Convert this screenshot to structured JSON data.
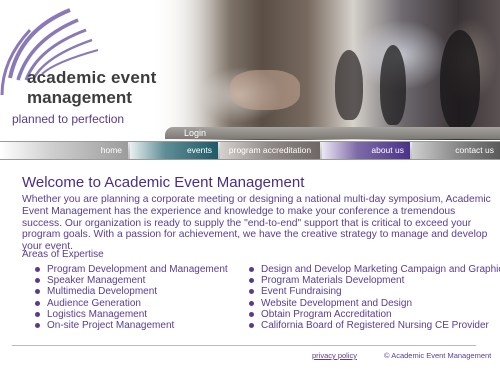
{
  "header": {
    "logo_line1": "academic event",
    "logo_line2": "management",
    "tagline": "planned to perfection",
    "login_label": "Login"
  },
  "nav": {
    "items": [
      {
        "label": "home"
      },
      {
        "label": "events"
      },
      {
        "label": "program accreditation"
      },
      {
        "label": "about us"
      },
      {
        "label": "contact us"
      }
    ]
  },
  "main": {
    "title": "Welcome to Academic Event Management",
    "intro": "Whether you are planning a corporate meeting or designing a national multi-day symposium, Academic Event Management has the experience and knowledge to make your conference a tremendous success. Our organization is ready to supply the \"end-to-end\" support that is critical to exceed your program goals. With a passion for achievement, we have the creative strategy to manage and develop your event.",
    "areas_heading": "Areas of Expertise",
    "areas_left": [
      "Program Development and Management",
      "Speaker Management",
      "Multimedia Development",
      "Audience Generation",
      "Logistics Management",
      "On-site Project Management"
    ],
    "areas_right": [
      "Design and Develop Marketing Campaign and Graphics",
      "Program Materials Development",
      "Event Fundraising",
      "Website Development and Design",
      "Obtain Program Accreditation",
      "California Board of Registered Nursing CE Provider"
    ]
  },
  "footer": {
    "privacy": "privacy policy",
    "copyright": "© Academic Event Management"
  },
  "colors": {
    "brand_purple": "#4a2d86",
    "events_teal": "#1f5a66",
    "about_purple": "#4a3287"
  }
}
